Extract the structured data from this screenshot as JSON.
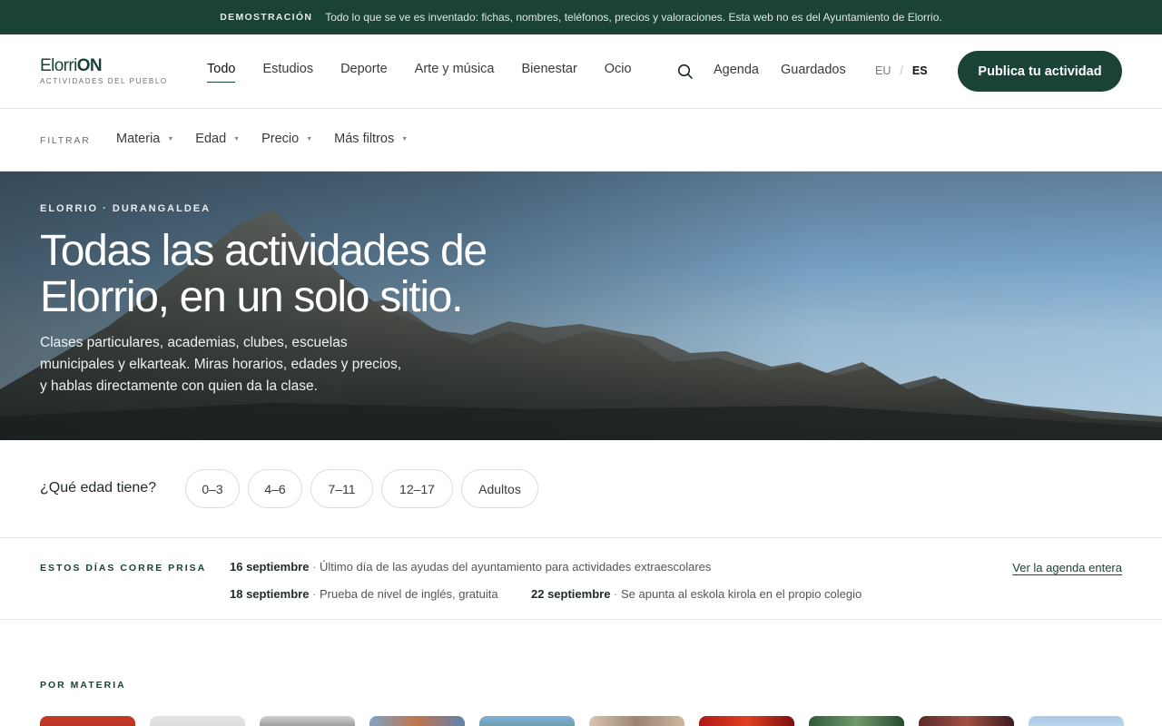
{
  "demo": {
    "tag": "DEMOSTRACIÓN",
    "message": "Todo lo que se ve es inventado: fichas, nombres, teléfonos, precios y valoraciones. Esta web no es del Ayuntamiento de Elorrio."
  },
  "header": {
    "logo_main_a": "Elorri",
    "logo_main_b": "ON",
    "logo_sub": "ACTIVIDADES DEL PUEBLO",
    "nav": [
      "Todo",
      "Estudios",
      "Deporte",
      "Arte y música",
      "Bienestar",
      "Ocio"
    ],
    "active_nav": "Todo",
    "agenda": "Agenda",
    "saved": "Guardados",
    "lang_eu": "EU",
    "lang_sep": "/",
    "lang_es": "ES",
    "publish": "Publica tu actividad"
  },
  "filters": {
    "label": "FILTRAR",
    "items": [
      "Materia",
      "Edad",
      "Precio",
      "Más filtros"
    ]
  },
  "hero": {
    "eyebrow": "ELORRIO · DURANGALDEA",
    "title": "Todas las actividades de Elorrio, en un solo sitio.",
    "description": "Clases particulares, academias, clubes, escuelas municipales y elkarteak. Miras horarios, edades y precios, y hablas directamente con quien da la clase."
  },
  "age": {
    "question": "¿Qué edad tiene?",
    "options": [
      "0–3",
      "4–6",
      "7–11",
      "12–17",
      "Adultos"
    ]
  },
  "urgent": {
    "label": "ESTOS DÍAS CORRE PRISA",
    "items": [
      {
        "date": "16 septiembre",
        "text": "Último día de las ayudas del ayuntamiento para actividades extraescolares"
      },
      {
        "date": "18 septiembre",
        "text": "Prueba de nivel de inglés, gratuita"
      },
      {
        "date": "22 septiembre",
        "text": "Se apunta al eskola kirola en el propio colegio"
      }
    ],
    "separator": " · ",
    "link": "Ver la agenda entera"
  },
  "materia": {
    "label": "POR MATERIA"
  },
  "colors": {
    "brand": "#1a4237",
    "banner": "#1a4237"
  }
}
